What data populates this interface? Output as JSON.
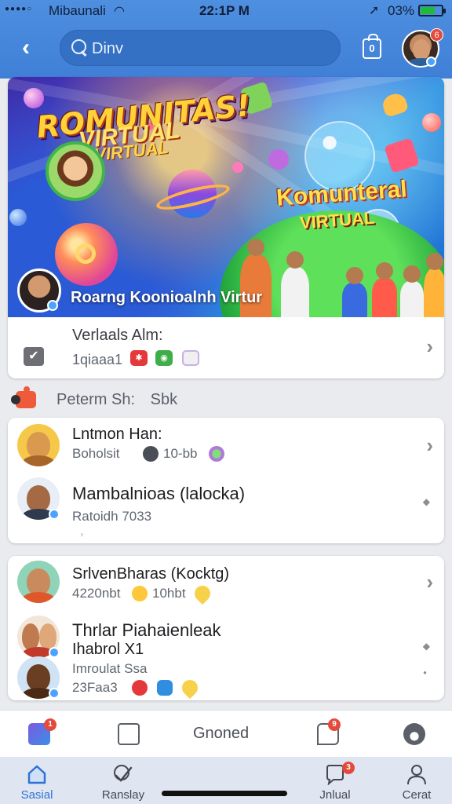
{
  "status_bar": {
    "carrier": "Mibaunali",
    "time": "22:1P M",
    "battery": "03%"
  },
  "header": {
    "search_text": "Dinv",
    "bag_label": "0",
    "avatar_badge": "6"
  },
  "banner": {
    "title_line1": "ROMUNITAS!",
    "title_line2": "VIRTUAL",
    "title_line3": "VIRTUAL",
    "sign_line1": "Komunteral",
    "sign_line2": "VIRTUAL",
    "caption": "Roarng Koonioalnh Virtur"
  },
  "info_row": {
    "title": "Verlaals Alm:",
    "subtitle": "1qiaaa1"
  },
  "section": {
    "label": "Peterm Sh:",
    "suffix": "Sbk"
  },
  "card1": {
    "rows": [
      {
        "title": "Lntmon Han:",
        "sub": "Boholsit",
        "count": "10-bb"
      },
      {
        "title": "Mambalnioas (lalocka)",
        "sub": "Ratoidh 7033",
        "extra": ","
      }
    ]
  },
  "card2": {
    "rows": [
      {
        "title": "SrlvenBharas  (Kocktg)",
        "sub": "4220nbt",
        "count": "10hbt"
      },
      {
        "title": "Thrlar Piahaienleak",
        "title2": "Ihabrol X1",
        "sub": "Imroulat Ssa",
        "sub2": "23Faa3"
      }
    ]
  },
  "action_bar": {
    "center_label": "Gnoned",
    "badge_left": "1",
    "badge_right": "9"
  },
  "tabbar": {
    "tabs": [
      {
        "label": "Sasial"
      },
      {
        "label": "Ranslay"
      },
      {
        "label": "Jnlual",
        "badge": "3"
      },
      {
        "label": "Cerat"
      }
    ]
  },
  "colors": {
    "header_blue": "#4f8fe0",
    "accent_blue": "#2f73d6",
    "badge_red": "#e44a3c"
  }
}
